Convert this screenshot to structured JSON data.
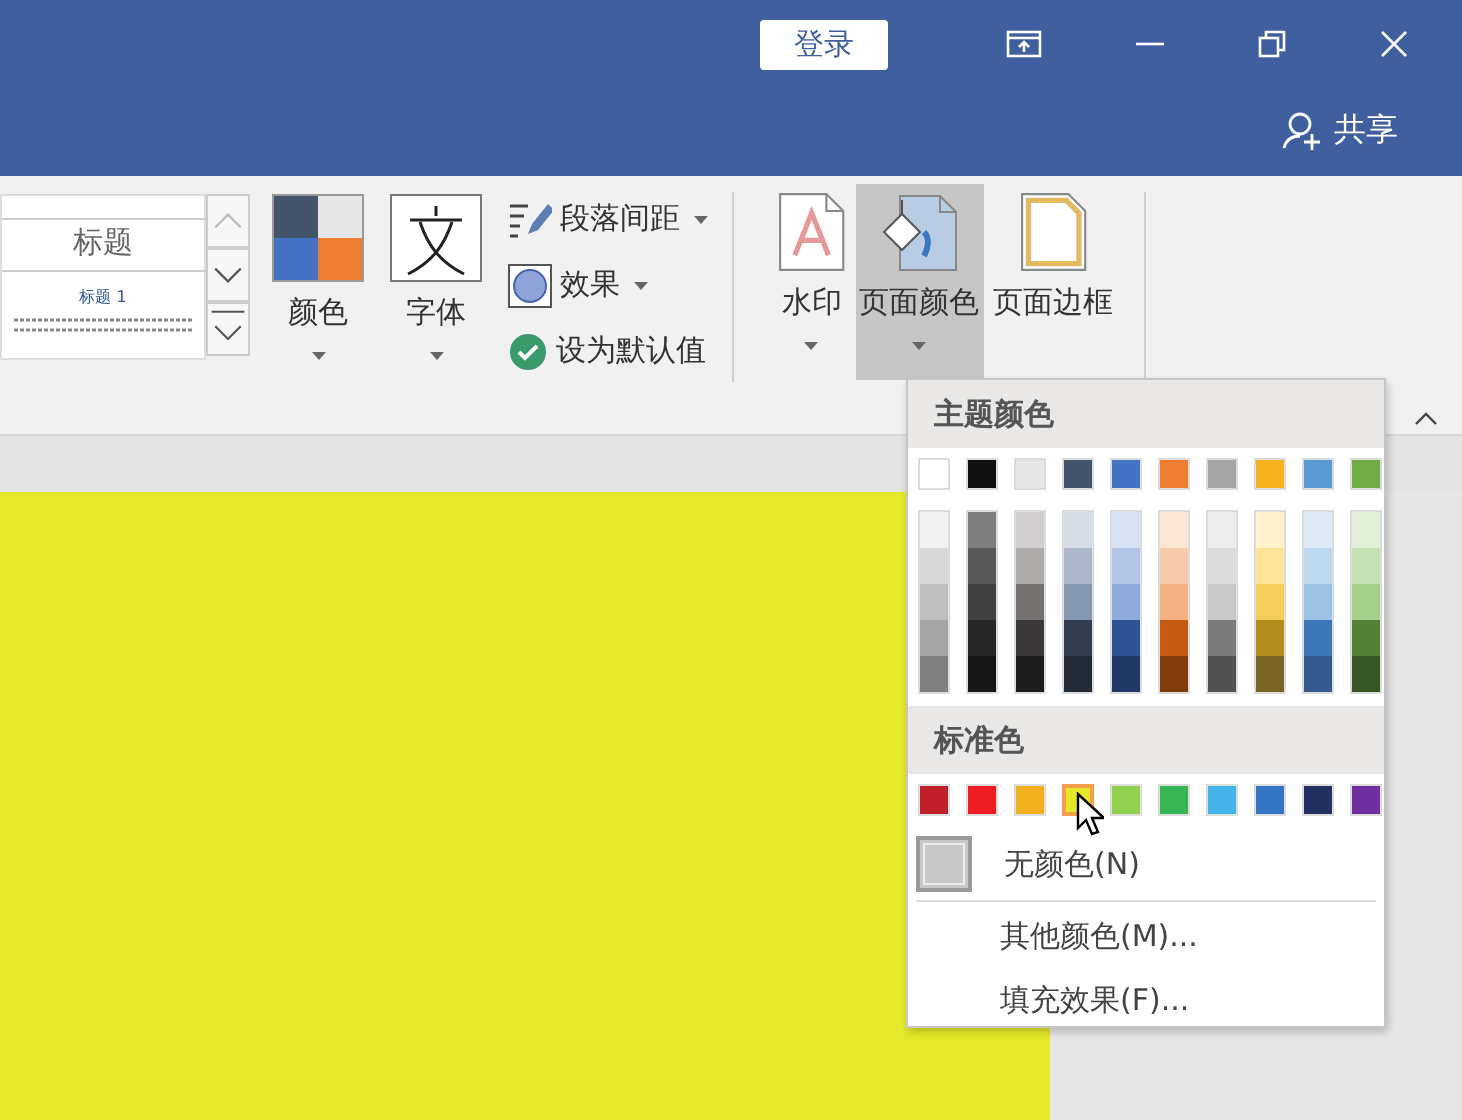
{
  "title_bar": {
    "sign_in": "登录",
    "share": "共享"
  },
  "ribbon": {
    "style_gallery": {
      "heading": "标题",
      "subheading": "标题 1"
    },
    "theme_buttons": [
      {
        "label": "颜色",
        "kind": "colors"
      },
      {
        "label": "字体",
        "kind": "fonts"
      }
    ],
    "small_buttons": [
      {
        "label": "段落间距",
        "kind": "spacing",
        "dropdown": true
      },
      {
        "label": "效果",
        "kind": "effects",
        "dropdown": true
      },
      {
        "label": "设为默认值",
        "kind": "default",
        "dropdown": false
      }
    ],
    "page_background": [
      {
        "label": "水印",
        "kind": "watermark",
        "dropdown": true,
        "selected": false
      },
      {
        "label": "页面颜色",
        "kind": "page-color",
        "dropdown": true,
        "selected": true
      },
      {
        "label": "页面边框",
        "kind": "page-borders",
        "dropdown": false,
        "selected": false
      }
    ]
  },
  "color_menu": {
    "theme_heading": "主题颜色",
    "theme_colors": [
      {
        "color": "#ffffff",
        "shades": [
          {
            "color": "#f2f2f2"
          },
          {
            "color": "#d9d9d9"
          },
          {
            "color": "#bfbfbf"
          },
          {
            "color": "#a6a6a6"
          },
          {
            "color": "#808080"
          }
        ]
      },
      {
        "color": "#111111",
        "shades": [
          {
            "color": "#7f7f7f"
          },
          {
            "color": "#595959"
          },
          {
            "color": "#404040"
          },
          {
            "color": "#262626"
          },
          {
            "color": "#171717"
          }
        ]
      },
      {
        "color": "#e7e6e6",
        "shades": [
          {
            "color": "#d0cece"
          },
          {
            "color": "#aeabab"
          },
          {
            "color": "#757171"
          },
          {
            "color": "#3a3838"
          },
          {
            "color": "#1c1c1c"
          }
        ]
      },
      {
        "color": "#44546a",
        "shades": [
          {
            "color": "#d6dce4"
          },
          {
            "color": "#adb9ca"
          },
          {
            "color": "#8497b0"
          },
          {
            "color": "#333f4f"
          },
          {
            "color": "#222a35"
          }
        ]
      },
      {
        "color": "#4472c4",
        "shades": [
          {
            "color": "#d9e2f3"
          },
          {
            "color": "#b4c6e7"
          },
          {
            "color": "#8eaadb"
          },
          {
            "color": "#2f5496"
          },
          {
            "color": "#1f3864"
          }
        ]
      },
      {
        "color": "#ed7d31",
        "shades": [
          {
            "color": "#fbe5d5"
          },
          {
            "color": "#f7cbac"
          },
          {
            "color": "#f4b183"
          },
          {
            "color": "#c55a11"
          },
          {
            "color": "#833c0b"
          }
        ]
      },
      {
        "color": "#a5a5a5",
        "shades": [
          {
            "color": "#ededed"
          },
          {
            "color": "#dbdbdb"
          },
          {
            "color": "#c9c9c9"
          },
          {
            "color": "#7b7b7b"
          },
          {
            "color": "#525252"
          }
        ]
      },
      {
        "color": "#f5b320",
        "shades": [
          {
            "color": "#fff2cc"
          },
          {
            "color": "#fee599"
          },
          {
            "color": "#f5cd5a"
          },
          {
            "color": "#b38e1f"
          },
          {
            "color": "#7a6424"
          }
        ]
      },
      {
        "color": "#5b9bd5",
        "shades": [
          {
            "color": "#deebf6"
          },
          {
            "color": "#bdd7ee"
          },
          {
            "color": "#9dc3e6"
          },
          {
            "color": "#3d78b8"
          },
          {
            "color": "#335a8a"
          }
        ]
      },
      {
        "color": "#70ad47",
        "shades": [
          {
            "color": "#e2efd9"
          },
          {
            "color": "#c5e0b3"
          },
          {
            "color": "#a8d08d"
          },
          {
            "color": "#538135"
          },
          {
            "color": "#375623"
          }
        ]
      }
    ],
    "standard_heading": "标准色",
    "standard_colors": [
      {
        "color": "#c0202a",
        "selected": false
      },
      {
        "color": "#ee1c25",
        "selected": false
      },
      {
        "color": "#f0b020",
        "selected": false
      },
      {
        "color": "#e6e92a",
        "selected": true
      },
      {
        "color": "#92d050",
        "selected": false
      },
      {
        "color": "#35b554",
        "selected": false
      },
      {
        "color": "#45b4e8",
        "selected": false
      },
      {
        "color": "#3476c4",
        "selected": false
      },
      {
        "color": "#243160",
        "selected": false
      },
      {
        "color": "#7030a0",
        "selected": false
      }
    ],
    "no_color": "无颜色(N)",
    "items": [
      "其他颜色(M)...",
      "填充效果(F)..."
    ]
  },
  "page": {
    "color": "#e4e92a"
  }
}
